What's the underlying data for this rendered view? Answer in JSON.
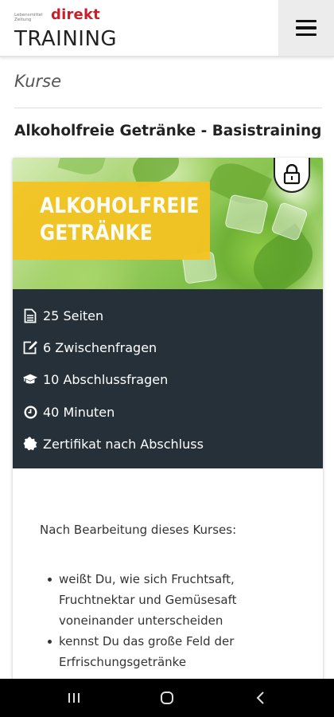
{
  "header": {
    "logo_small": "Lebensmittel Zeitung",
    "logo_brand": "direkt",
    "logo_main": "TRAINING",
    "menu_icon": "hamburger-menu-icon"
  },
  "breadcrumb": "Kurse",
  "page_title": "Alkoholfreie Getränke - Basistraining",
  "course": {
    "banner_line1": "ALKOHOLFREIE",
    "banner_line2": "GETRÄNKE",
    "lock_icon": "lock-icon",
    "info": [
      {
        "icon": "document-icon",
        "text": "25 Seiten"
      },
      {
        "icon": "edit-icon",
        "text": "6 Zwischenfragen"
      },
      {
        "icon": "graduation-cap-icon",
        "text": "10 Abschlussfragen"
      },
      {
        "icon": "clock-icon",
        "text": "40 Minuten"
      },
      {
        "icon": "certificate-icon",
        "text": "Zertifikat nach Abschluss"
      }
    ],
    "description_intro": "Nach Bearbeitung dieses Kurses:",
    "description_items": [
      "weißt Du, wie sich Fruchtsaft, Fruchtnektar und Gemüsesaft voneinander unterscheiden",
      "kennst Du das große Feld der Erfrischungsgetränke"
    ]
  },
  "navbar": {
    "recent_icon": "recent-apps-icon",
    "home_icon": "home-icon",
    "back_icon": "back-icon"
  },
  "colors": {
    "brand_red": "#c8202b",
    "banner_yellow": "#f4c321",
    "info_panel": "#263038"
  }
}
